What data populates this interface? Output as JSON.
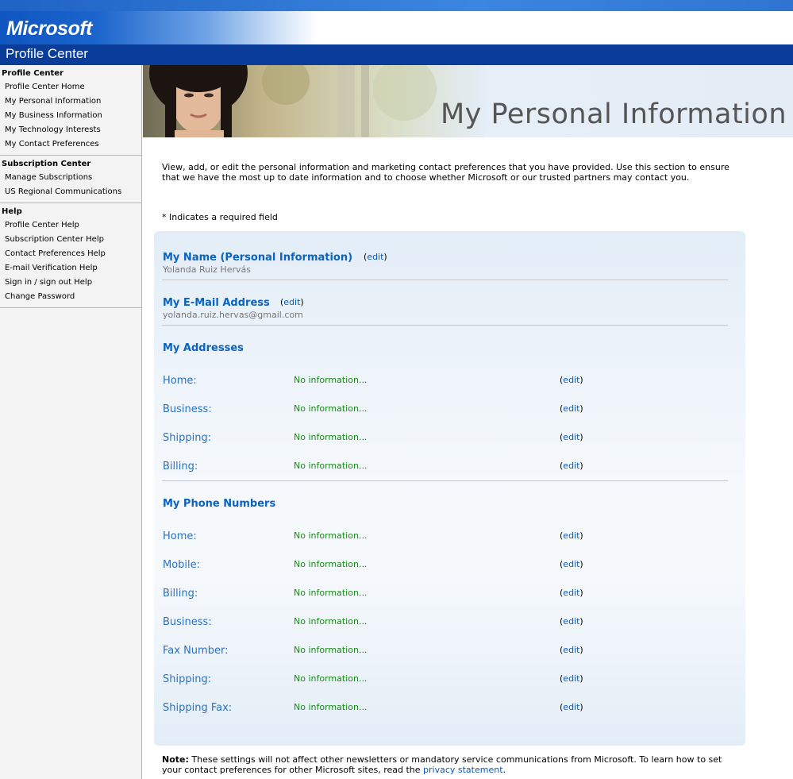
{
  "header": {
    "logo_text": "Microsoft",
    "site_title": "Profile Center",
    "colors": {
      "brand_blue": "#0a3d9a",
      "link_blue": "#0a63c0",
      "value_green": "#1a8a1a"
    }
  },
  "sidebar": {
    "groups": [
      {
        "heading": "Profile Center",
        "items": [
          "Profile Center Home",
          "My Personal Information",
          "My Business Information",
          "My Technology Interests",
          "My Contact Preferences"
        ]
      },
      {
        "heading": "Subscription Center",
        "items": [
          "Manage Subscriptions",
          "US Regional Communications"
        ]
      },
      {
        "heading": "Help",
        "items": [
          "Profile Center Help",
          "Subscription Center Help",
          "Contact Preferences Help",
          "E-mail Verification Help",
          "Sign in / sign out Help",
          "Change Password"
        ]
      }
    ]
  },
  "banner": {
    "title": "My Personal Information"
  },
  "intro": "View, add, or edit the personal information and marketing contact preferences that you have provided. Use this section to ensure that we have the most up to date information and to choose whether Microsoft or our trusted partners may contact you.",
  "required_note": "* Indicates a required field",
  "edit_label": "edit",
  "name_section": {
    "title": "My Name (Personal Information)",
    "value": "Yolanda Ruiz Hervás"
  },
  "email_section": {
    "title": "My E-Mail Address",
    "value": "yolanda.ruiz.hervas@gmail.com"
  },
  "addresses": {
    "title": "My Addresses",
    "rows": [
      {
        "label": "Home:",
        "value": "No information..."
      },
      {
        "label": "Business:",
        "value": "No information..."
      },
      {
        "label": "Shipping:",
        "value": "No information..."
      },
      {
        "label": "Billing:",
        "value": "No information..."
      }
    ]
  },
  "phones": {
    "title": "My Phone Numbers",
    "rows": [
      {
        "label": "Home:",
        "value": "No information..."
      },
      {
        "label": "Mobile:",
        "value": "No information..."
      },
      {
        "label": "Billing:",
        "value": "No information..."
      },
      {
        "label": "Business:",
        "value": "No information..."
      },
      {
        "label": "Fax Number:",
        "value": "No information..."
      },
      {
        "label": "Shipping:",
        "value": "No information..."
      },
      {
        "label": "Shipping Fax:",
        "value": "No information..."
      }
    ]
  },
  "note": {
    "bold": "Note:",
    "text": " These settings will not affect other newsletters or mandatory service communications from Microsoft. To learn how to set your contact preferences for other Microsoft sites, read the ",
    "link": "privacy statement",
    "end": "."
  }
}
